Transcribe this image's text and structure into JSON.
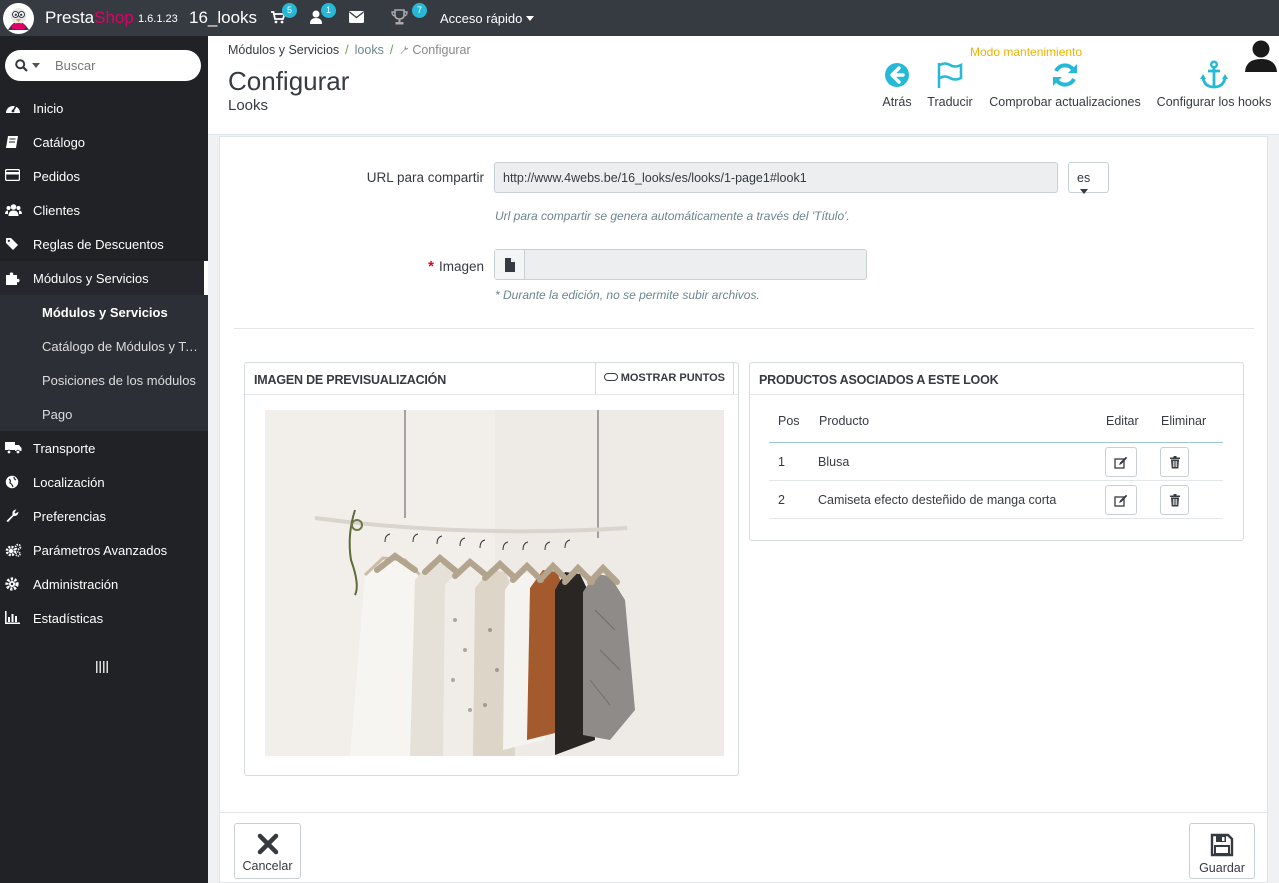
{
  "topbar": {
    "brand_part1": "Presta",
    "brand_part2": "Shop",
    "version": "1.6.1.23",
    "shop_name": "16_looks",
    "cart_count": "5",
    "customers_count": "1",
    "trophy_count": "7",
    "quick_access": "Acceso rápido"
  },
  "search": {
    "placeholder": "Buscar"
  },
  "sidebar": {
    "items": [
      {
        "label": "Inicio",
        "icon": "dashboard-icon"
      },
      {
        "label": "Catálogo",
        "icon": "book-icon"
      },
      {
        "label": "Pedidos",
        "icon": "credit-card-icon"
      },
      {
        "label": "Clientes",
        "icon": "users-icon"
      },
      {
        "label": "Reglas de Descuentos",
        "icon": "tags-icon"
      },
      {
        "label": "Módulos y Servicios",
        "icon": "puzzle-icon"
      },
      {
        "label": "Transporte",
        "icon": "truck-icon"
      },
      {
        "label": "Localización",
        "icon": "globe-icon"
      },
      {
        "label": "Preferencias",
        "icon": "wrench-icon"
      },
      {
        "label": "Parámetros Avanzados",
        "icon": "cogs-icon"
      },
      {
        "label": "Administración",
        "icon": "cog-icon"
      },
      {
        "label": "Estadísticas",
        "icon": "bar-chart-icon"
      }
    ],
    "submenu": [
      {
        "label": "Módulos y Servicios"
      },
      {
        "label": "Catálogo de Módulos y Temas"
      },
      {
        "label": "Posiciones de los módulos"
      },
      {
        "label": "Pago"
      }
    ]
  },
  "breadcrumb": {
    "c1": "Módulos y Servicios",
    "sep": "/",
    "c2": "looks",
    "c3": "Configurar"
  },
  "page": {
    "title": "Configurar",
    "subtitle": "Looks",
    "maintenance": "Modo mantenimiento"
  },
  "toolbar": {
    "back": "Atrás",
    "translate": "Traducir",
    "check_updates": "Comprobar actualizaciones",
    "hooks": "Configurar los hooks"
  },
  "form": {
    "url_label": "URL para compartir",
    "url_value": "http://www.4webs.be/16_looks/es/looks/1-page1#look1",
    "lang": "es",
    "url_help": "Url para compartir se genera automáticamente a través del 'Título'.",
    "image_label": "Imagen",
    "image_help": "* Durante la edición, no se permite subir archivos."
  },
  "preview": {
    "title": "IMAGEN DE PREVISUALIZACIÓN",
    "show_points": "MOSTRAR PUNTOS"
  },
  "products": {
    "title": "PRODUCTOS ASOCIADOS A ESTE LOOK",
    "headers": {
      "pos": "Pos",
      "product": "Producto",
      "edit": "Editar",
      "delete": "Eliminar"
    },
    "rows": [
      {
        "pos": "1",
        "product": "Blusa"
      },
      {
        "pos": "2",
        "product": "Camiseta efecto desteñido de manga corta"
      }
    ]
  },
  "footer": {
    "cancel": "Cancelar",
    "save": "Guardar"
  },
  "colors": {
    "accent": "#25b9d7",
    "brand": "#df0067",
    "warning": "#efb300",
    "sidebar": "#202226"
  }
}
